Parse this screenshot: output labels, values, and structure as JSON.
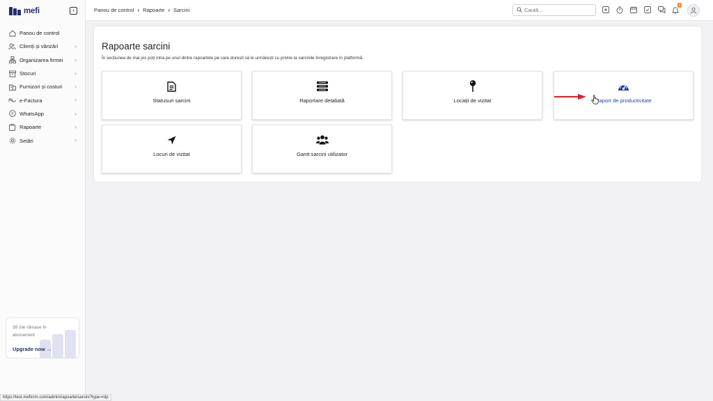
{
  "brand": {
    "name": "mefi",
    "color": "#2a2d6e"
  },
  "sidebar": {
    "items": [
      {
        "label": "Panou de control",
        "icon": "home-icon",
        "chevron": false
      },
      {
        "label": "Clienți și vânzări",
        "icon": "users-icon",
        "chevron": true
      },
      {
        "label": "Organizarea firmei",
        "icon": "org-icon",
        "chevron": true
      },
      {
        "label": "Stocuri",
        "icon": "box-icon",
        "chevron": true
      },
      {
        "label": "Furnizori și costuri",
        "icon": "building-icon",
        "chevron": true
      },
      {
        "label": "e-Factura",
        "icon": "efactura-icon",
        "chevron": true
      },
      {
        "label": "WhatsApp",
        "icon": "chat-icon",
        "chevron": true
      },
      {
        "label": "Rapoarte",
        "icon": "clipboard-icon",
        "chevron": true
      },
      {
        "label": "Setări",
        "icon": "gear-icon",
        "chevron": true
      }
    ],
    "trial": {
      "text": "39 zile rămase în abonament",
      "link": "Upgrade now"
    }
  },
  "header": {
    "breadcrumb": [
      "Panou de control",
      "Rapoarte",
      "Sarcini"
    ],
    "search_placeholder": "Caută...",
    "notification_count": "1"
  },
  "main": {
    "title": "Rapoarte sarcini",
    "description": "În secțiunea de mai jos poți intra pe unul dintre rapoartele pe care dorești să le urmărești cu privire la sarcinile înregistrare în platformă.",
    "tiles": [
      {
        "label": "Statusuri sarcini",
        "icon": "document-icon"
      },
      {
        "label": "Raportare detaliată",
        "icon": "list-icon"
      },
      {
        "label": "Locații de vizitat",
        "icon": "pin-icon"
      },
      {
        "label": "Raport de productivitate",
        "icon": "speedometer-icon"
      },
      {
        "label": "Locuri de vizitat",
        "icon": "location-arrow-icon"
      },
      {
        "label": "Gantt sarcini utilizator",
        "icon": "group-icon"
      }
    ]
  },
  "accent_color": "#2a3ea8",
  "arrow_color": "#e02020",
  "status_url": "https://test.meficrm.com/admin/rapoarte/sarcini?type=rdp"
}
